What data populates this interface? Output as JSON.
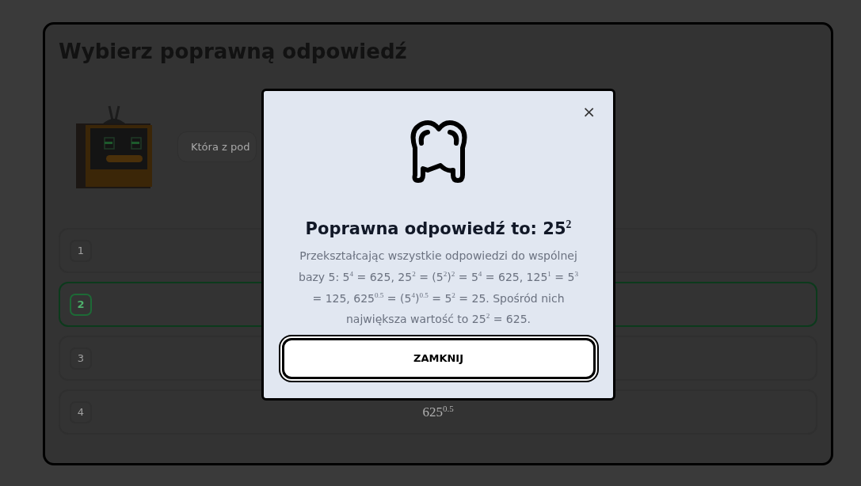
{
  "quiz": {
    "title": "Wybierz poprawną odpowiedź",
    "question": "Która z pod",
    "options": [
      {
        "number": "1",
        "selected": false
      },
      {
        "number": "2",
        "selected": true
      },
      {
        "number": "3",
        "selected": false
      },
      {
        "number": "4",
        "selected": false,
        "text": "625$^{0.5}$"
      }
    ]
  },
  "result_dialog": {
    "close": "×",
    "heading": "Poprawna odpowiedź to: 25$^{2}$",
    "explanation": "Przekształcając wszystkie odpowiedzi do wspólnej bazy 5: 5$^{4}$ = 625, 25$^{2}$ = (5$^{2}$)$^{2}$ = 5$^{4}$ = 625, 125$^{1}$ = 5$^{3}$ = 125, 625$^{0.5}$ = (5$^{4}$)$^{0.5}$ = 5$^{2}$ = 25. Spośród nich największa wartość to 25$^{2}$ = 625.",
    "button": "ZAMKNIJ"
  }
}
